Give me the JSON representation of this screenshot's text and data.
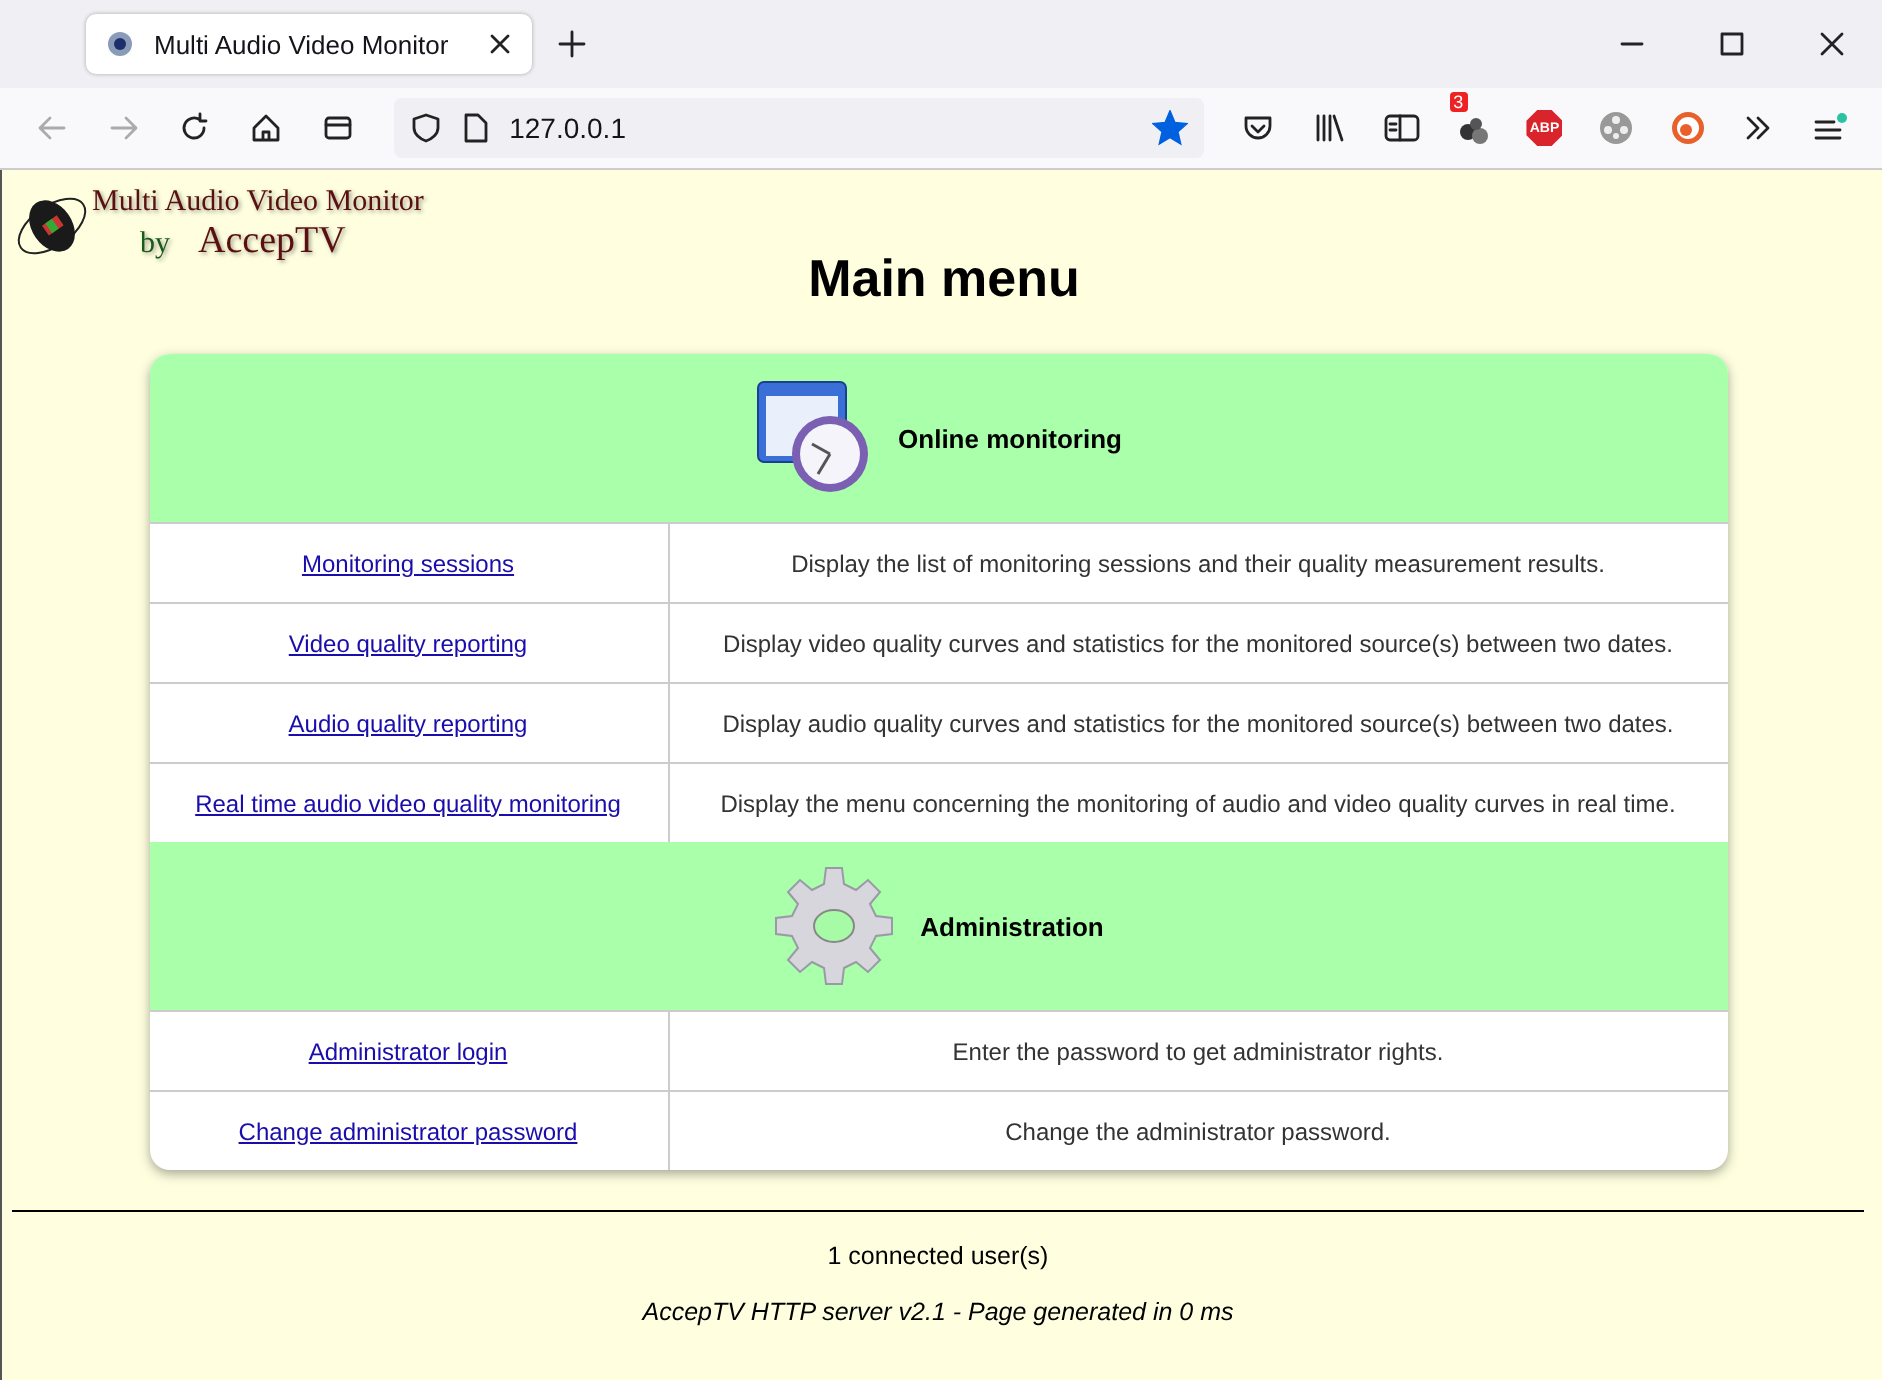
{
  "browser": {
    "tab": {
      "title": "Multi Audio Video Monitor",
      "selected": true
    },
    "address": "127.0.0.1",
    "bookmarked": true,
    "extension_badge": "3",
    "abp_label": "ABP"
  },
  "logo": {
    "title": "Multi Audio Video Monitor",
    "by": "by",
    "brand": "AccepTV"
  },
  "heading": "Main menu",
  "sections": [
    {
      "title": "Online monitoring",
      "kind": "clock",
      "items": [
        {
          "link": "Monitoring sessions",
          "description": "Display the list of monitoring sessions and their quality measurement results."
        },
        {
          "link": "Video quality reporting",
          "description": "Display video quality curves and statistics for the monitored source(s) between two dates."
        },
        {
          "link": "Audio quality reporting",
          "description": "Display audio quality curves and statistics for the monitored source(s) between two dates."
        },
        {
          "link": "Real time audio video quality monitoring",
          "description": "Display the menu concerning the monitoring of audio and video quality curves in real time."
        }
      ]
    },
    {
      "title": "Administration",
      "kind": "gear",
      "items": [
        {
          "link": "Administrator login",
          "description": "Enter the password to get administrator rights."
        },
        {
          "link": "Change administrator password",
          "description": "Change the administrator password."
        }
      ]
    }
  ],
  "footer": {
    "users": "1 connected user(s)",
    "server": "AccepTV HTTP server v2.1 - Page generated in 0 ms"
  }
}
